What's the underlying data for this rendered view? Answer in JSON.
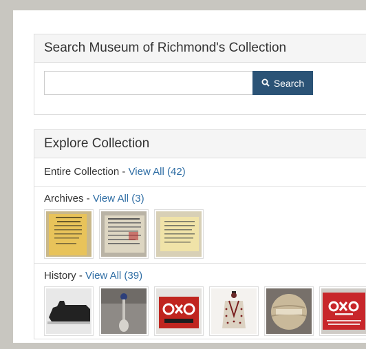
{
  "search": {
    "title": "Search Museum of Richmond's Collection",
    "input_value": "",
    "button_label": "Search"
  },
  "explore": {
    "title": "Explore Collection",
    "entire": {
      "label": "Entire Collection - ",
      "link": "View All (42)"
    },
    "archives": {
      "label": "Archives - ",
      "link": "View All (3)",
      "thumbnails": [
        "archive-document-1",
        "archive-document-2",
        "archive-document-3"
      ]
    },
    "history": {
      "label": "History - ",
      "link": "View All (39)",
      "thumbnails": [
        "black-iron-object",
        "souvenir-spoon",
        "oxo-cubes-tin",
        "beaded-garment",
        "ball-of-string",
        "oxo-cubes-tin-2"
      ]
    }
  },
  "colors": {
    "button": "#2b5376",
    "link": "#2e6da4"
  }
}
